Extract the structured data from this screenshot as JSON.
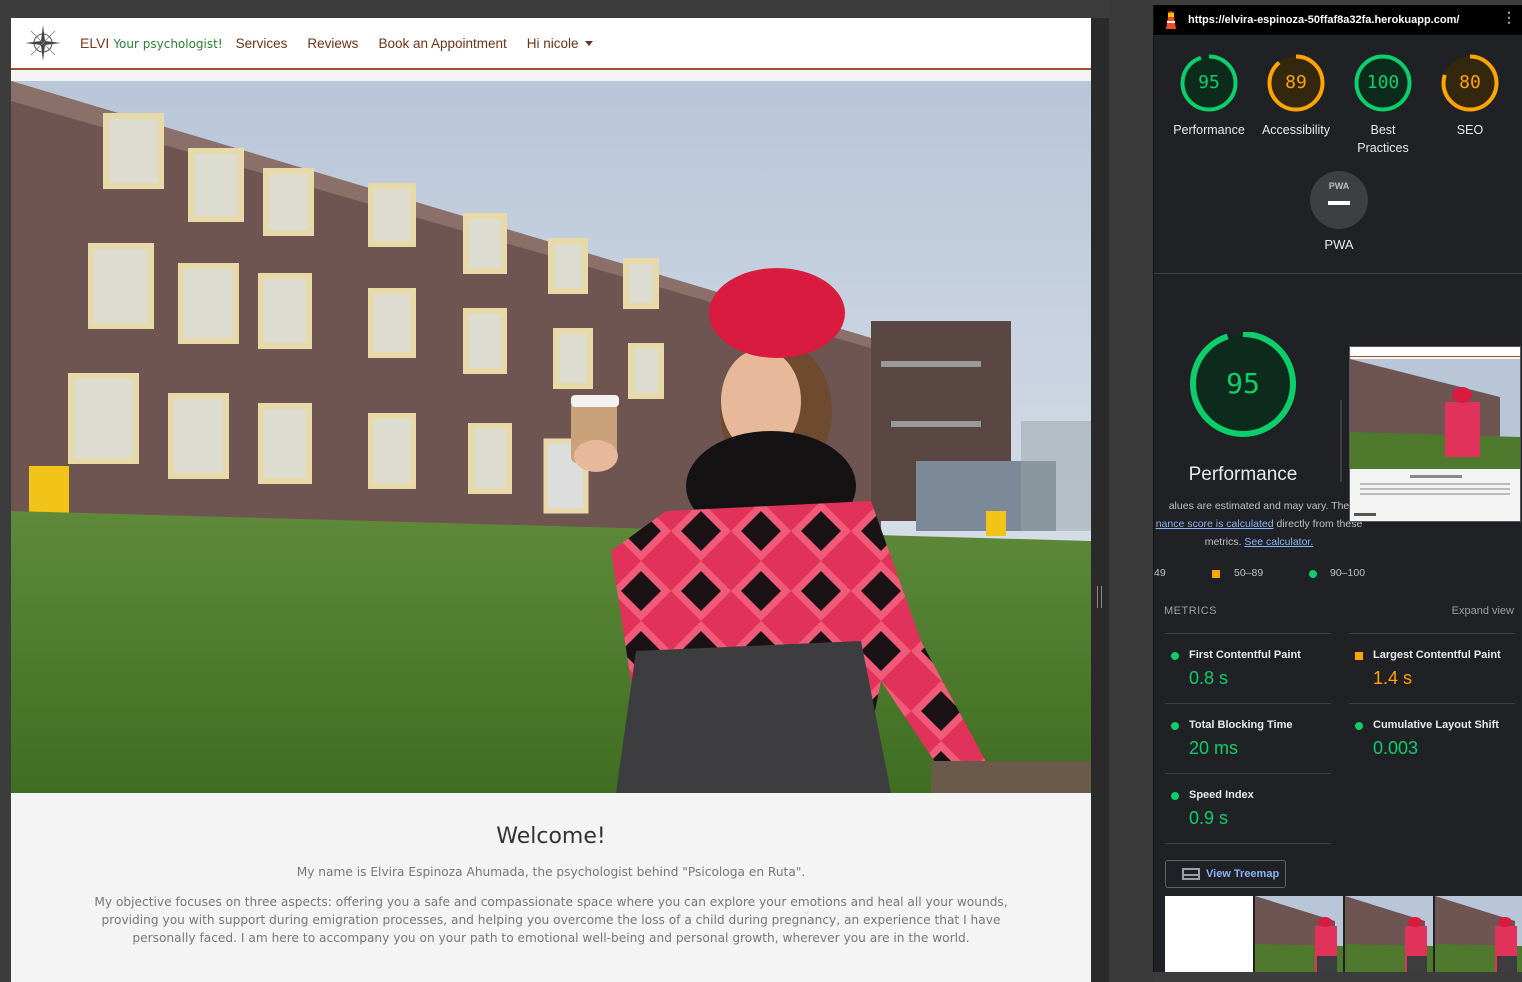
{
  "site": {
    "brand": "ELVI",
    "brand_tagline": "Your psychologist!",
    "nav": [
      "Services",
      "Reviews",
      "Book an Appointment",
      "Hi nicole"
    ],
    "welcome_title": "Welcome!",
    "welcome_p1": "My name is Elvira Espinoza Ahumada, the psychologist behind \"Psicologa en Ruta\".",
    "welcome_p2": "My objective focuses on three aspects: offering you a safe and compassionate space where you can explore your emotions and heal all your wounds, providing you with support during emigration processes, and helping you overcome the loss of a child during pregnancy, an experience that I have personally faced. I am here to accompany you on your path to emotional well-being and personal growth, wherever you are in the world."
  },
  "lighthouse": {
    "url": "https://elvira-espinoza-50ffaf8a32fa.herokuapp.com/",
    "scores": [
      {
        "label": "Performance",
        "value": "95",
        "color": "#0cce6b"
      },
      {
        "label": "Accessibility",
        "value": "89",
        "color": "#ffa400"
      },
      {
        "label": "Best Practices",
        "value": "100",
        "color": "#0cce6b"
      },
      {
        "label": "SEO",
        "value": "80",
        "color": "#ffa400"
      }
    ],
    "pwa_badge": "PWA",
    "pwa_label": "PWA",
    "big_score": "95",
    "big_label": "Performance",
    "note_line1": "alues are estimated and may vary. The",
    "note_link1": "nance score is calculated",
    "note_line2": " directly from these",
    "note_line3": "metrics. ",
    "note_link2": "See calculator.",
    "legend": [
      "49",
      "50–89",
      "90–100"
    ],
    "metrics_title": "METRICS",
    "expand_label": "Expand view",
    "metrics": [
      {
        "name": "First Contentful Paint",
        "value": "0.8 s",
        "status": "green"
      },
      {
        "name": "Largest Contentful Paint",
        "value": "1.4 s",
        "status": "orange"
      },
      {
        "name": "Total Blocking Time",
        "value": "20 ms",
        "status": "green"
      },
      {
        "name": "Cumulative Layout Shift",
        "value": "0.003",
        "status": "green"
      },
      {
        "name": "Speed Index",
        "value": "0.9 s",
        "status": "green"
      }
    ],
    "treemap_label": "View Treemap",
    "colors": {
      "pass": "#0cce6b",
      "average": "#ffa400",
      "fail": "#ff4e42"
    }
  }
}
